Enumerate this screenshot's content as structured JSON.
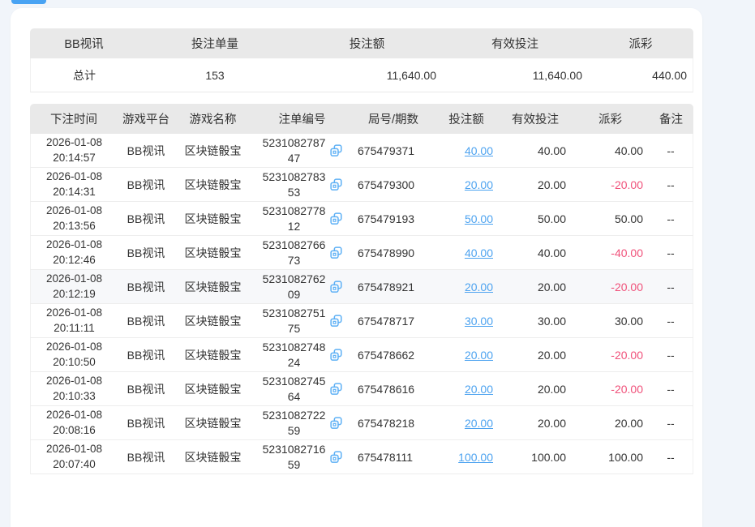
{
  "colors": {
    "accent_blue": "#49a3f3",
    "link_blue": "#4da3f0",
    "negative_pink": "#f0517a",
    "header_gray": "#e9e9e9",
    "page_background": "#f1f5fa"
  },
  "summary_table": {
    "headers": [
      "BB视讯",
      "投注单量",
      "投注额",
      "有效投注",
      "派彩"
    ],
    "total_row": {
      "label": "总计",
      "bet_count": "153",
      "bet_amount": "11,640.00",
      "valid_bet": "11,640.00",
      "payout": "440.00"
    }
  },
  "detail_table": {
    "headers": [
      "下注时间",
      "游戏平台",
      "游戏名称",
      "注单编号",
      "局号/期数",
      "投注额",
      "有效投注",
      "派彩",
      "备注"
    ],
    "rows": [
      {
        "date": "2026-01-08",
        "time": "20:14:57",
        "platform": "BB视讯",
        "game": "区块链骰宝",
        "order_no": "523108278747",
        "round_no": "675479371",
        "bet_amount": "40.00",
        "valid_bet": "40.00",
        "payout": "40.00",
        "remark": "--",
        "highlighted": false
      },
      {
        "date": "2026-01-08",
        "time": "20:14:31",
        "platform": "BB视讯",
        "game": "区块链骰宝",
        "order_no": "523108278353",
        "round_no": "675479300",
        "bet_amount": "20.00",
        "valid_bet": "20.00",
        "payout": "-20.00",
        "remark": "--",
        "highlighted": false
      },
      {
        "date": "2026-01-08",
        "time": "20:13:56",
        "platform": "BB视讯",
        "game": "区块链骰宝",
        "order_no": "523108277812",
        "round_no": "675479193",
        "bet_amount": "50.00",
        "valid_bet": "50.00",
        "payout": "50.00",
        "remark": "--",
        "highlighted": false
      },
      {
        "date": "2026-01-08",
        "time": "20:12:46",
        "platform": "BB视讯",
        "game": "区块链骰宝",
        "order_no": "523108276673",
        "round_no": "675478990",
        "bet_amount": "40.00",
        "valid_bet": "40.00",
        "payout": "-40.00",
        "remark": "--",
        "highlighted": false
      },
      {
        "date": "2026-01-08",
        "time": "20:12:19",
        "platform": "BB视讯",
        "game": "区块链骰宝",
        "order_no": "523108276209",
        "round_no": "675478921",
        "bet_amount": "20.00",
        "valid_bet": "20.00",
        "payout": "-20.00",
        "remark": "--",
        "highlighted": true
      },
      {
        "date": "2026-01-08",
        "time": "20:11:11",
        "platform": "BB视讯",
        "game": "区块链骰宝",
        "order_no": "523108275175",
        "round_no": "675478717",
        "bet_amount": "30.00",
        "valid_bet": "30.00",
        "payout": "30.00",
        "remark": "--",
        "highlighted": false
      },
      {
        "date": "2026-01-08",
        "time": "20:10:50",
        "platform": "BB视讯",
        "game": "区块链骰宝",
        "order_no": "523108274824",
        "round_no": "675478662",
        "bet_amount": "20.00",
        "valid_bet": "20.00",
        "payout": "-20.00",
        "remark": "--",
        "highlighted": false
      },
      {
        "date": "2026-01-08",
        "time": "20:10:33",
        "platform": "BB视讯",
        "game": "区块链骰宝",
        "order_no": "523108274564",
        "round_no": "675478616",
        "bet_amount": "20.00",
        "valid_bet": "20.00",
        "payout": "-20.00",
        "remark": "--",
        "highlighted": false
      },
      {
        "date": "2026-01-08",
        "time": "20:08:16",
        "platform": "BB视讯",
        "game": "区块链骰宝",
        "order_no": "523108272259",
        "round_no": "675478218",
        "bet_amount": "20.00",
        "valid_bet": "20.00",
        "payout": "20.00",
        "remark": "--",
        "highlighted": false
      },
      {
        "date": "2026-01-08",
        "time": "20:07:40",
        "platform": "BB视讯",
        "game": "区块链骰宝",
        "order_no": "523108271659",
        "round_no": "675478111",
        "bet_amount": "100.00",
        "valid_bet": "100.00",
        "payout": "100.00",
        "remark": "--",
        "highlighted": false
      }
    ]
  }
}
